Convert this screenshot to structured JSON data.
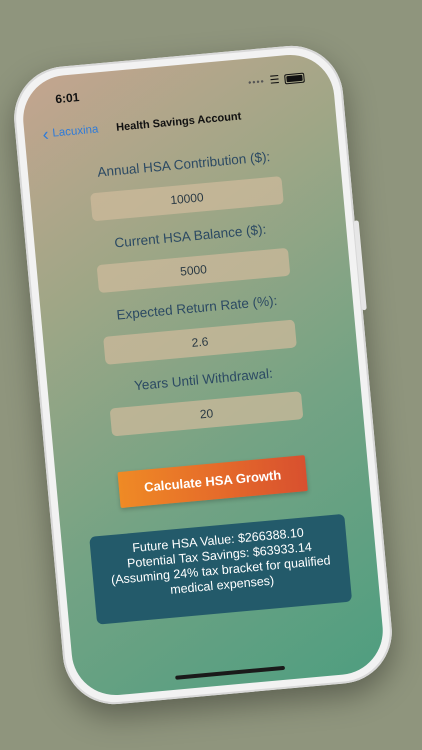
{
  "status_bar": {
    "time": "6:01"
  },
  "nav": {
    "back_label": "Lacuxina",
    "title": "Health Savings Account"
  },
  "form": {
    "contribution_label": "Annual HSA Contribution ($):",
    "contribution_value": "10000",
    "balance_label": "Current HSA Balance ($):",
    "balance_value": "5000",
    "rate_label": "Expected Return Rate (%):",
    "rate_value": "2.6",
    "years_label": "Years Until Withdrawal:",
    "years_value": "20"
  },
  "calculate_button": "Calculate HSA Growth",
  "result": {
    "line1": "Future HSA Value: $266388.10",
    "line2": "Potential Tax Savings: $63933.14",
    "line3": "(Assuming 24% tax bracket for qualified",
    "line4": "medical expenses)"
  },
  "colors": {
    "background": "#8f957d",
    "button_orange": "#e56a2a",
    "result_box": "#235a6a",
    "back_link": "#2f7bd8",
    "label_text": "#2c4a63"
  },
  "icons": {
    "back": "chevron-left-icon",
    "wifi": "wifi-icon",
    "battery": "battery-icon"
  }
}
